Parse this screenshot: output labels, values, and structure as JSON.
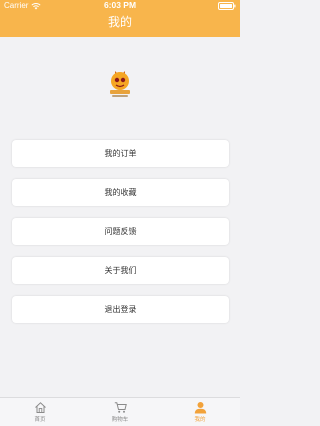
{
  "status_bar": {
    "carrier": "Carrier",
    "time": "6:03 PM"
  },
  "header": {
    "title": "我的"
  },
  "logo": {
    "icon": "app-logo"
  },
  "menu": {
    "items": [
      {
        "label": "我的订单"
      },
      {
        "label": "我的收藏"
      },
      {
        "label": "问题反馈"
      },
      {
        "label": "关于我们"
      },
      {
        "label": "退出登录"
      }
    ]
  },
  "tab_bar": {
    "tabs": [
      {
        "label": "首页",
        "icon": "home-icon",
        "active": false
      },
      {
        "label": "购物车",
        "icon": "cart-icon",
        "active": false
      },
      {
        "label": "我的",
        "icon": "profile-icon",
        "active": true
      }
    ]
  },
  "colors": {
    "brand": "#f8b54c",
    "active_tab": "#f2a23a"
  }
}
